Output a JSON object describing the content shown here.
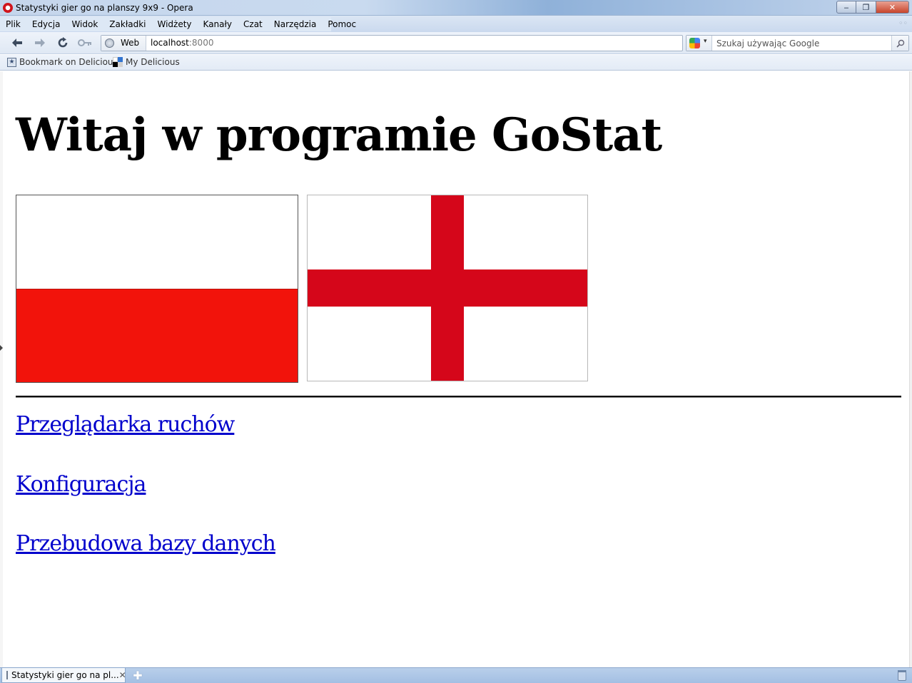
{
  "window": {
    "title": "Statystyki gier go na planszy 9x9 - Opera",
    "minimize": "‒",
    "maximize": "❐",
    "close": "✕"
  },
  "menu": {
    "items": [
      "Plik",
      "Edycja",
      "Widok",
      "Zakładki",
      "Widżety",
      "Kanały",
      "Czat",
      "Narzędzia",
      "Pomoc"
    ]
  },
  "toolbar": {
    "address_badge": "Web",
    "address_host": "localhost",
    "address_port": ":8000",
    "search_placeholder": "Szukaj używając Google"
  },
  "bookmarks": {
    "items": [
      "Bookmark on Delicious",
      "My Delicious"
    ]
  },
  "page": {
    "heading": "Witaj w programie GoStat",
    "links": [
      "Przeglądarka ruchów",
      "Konfiguracja",
      "Przebudowa bazy danych"
    ]
  },
  "tabs": {
    "active_label": "Statystyki gier go na pl..."
  },
  "colors": {
    "flag_pl_red": "#f2130b",
    "flag_en_red": "#d5061a",
    "link": "#0000cc"
  },
  "icons": {
    "back": "back-arrow-icon",
    "forward": "forward-arrow-icon",
    "reload": "reload-icon",
    "wand": "key-icon",
    "globe": "globe-icon",
    "search_engine": "google-icon",
    "search": "magnifier-icon"
  }
}
